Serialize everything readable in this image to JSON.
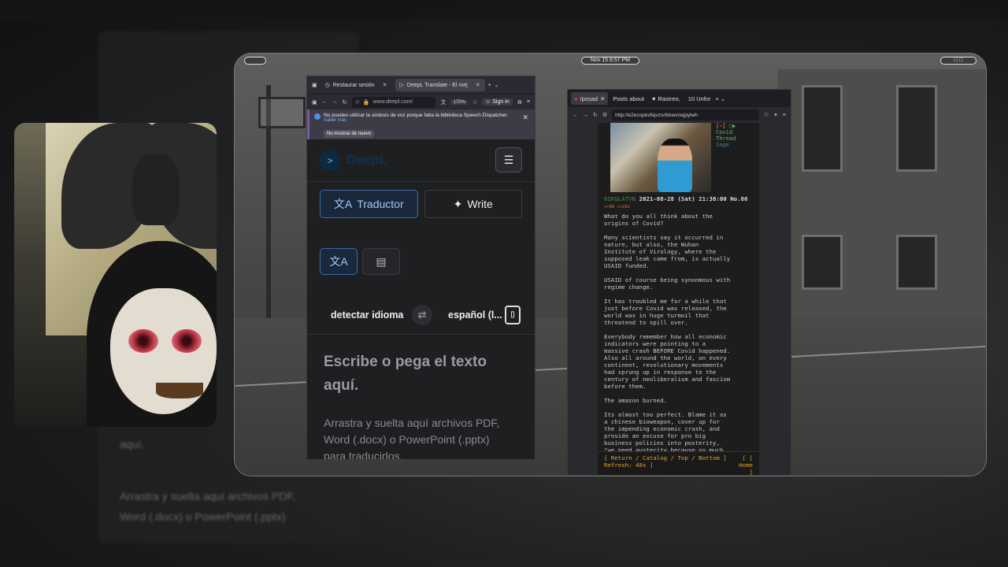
{
  "topbar": {
    "clock": "Nov 15   8:57 PM"
  },
  "deepl_window": {
    "tabs": [
      {
        "label": "Restaurar sesión"
      },
      {
        "label": "DeepL Translate - El mej"
      }
    ],
    "url": "www.deepl.com/",
    "zoom": "170%",
    "signin": "Sign in",
    "notice": {
      "text": "No puedes utilizar la síntesis de voz porque falta la biblioteca Speech Dispatcher.",
      "link": "Saber más",
      "button": "No mostrar de nuevo"
    },
    "brand": "DeepL",
    "modes": {
      "translator": "Traductor",
      "write": "Write"
    },
    "lang_source": "detectar idioma",
    "lang_target": "español (l...",
    "source_placeholder": "Escribe o pega el texto aquí.",
    "source_hint": "Arrastra y suelta aquí archivos PDF, Word (.docx) o PowerPoint (.pptx) para traducirlos."
  },
  "tor_window": {
    "tabs": [
      {
        "label": "/posad"
      },
      {
        "label": "Posts about"
      },
      {
        "label": "Rastreo,"
      },
      {
        "label": "10 Unfor"
      }
    ],
    "url": "http://e2ecopkv6qvzsrbikwxnejpylwh",
    "side": {
      "collapse": "[−]",
      "title1": "Covid",
      "title2": "Thread",
      "sage": "Sage"
    },
    "post": {
      "name": "6IKGLATVN",
      "date": "2021-08-28 (Sat) 21:38:00",
      "number": "No.86",
      "refs": ">>88 >>262",
      "body": "What do you all think about the\norigins of Covid?\n\nMany scientists say it occurred in\nnature, but also, the Wuhan\nInstitute of Virology, where the\nsupposed leak came from, is actually\nUSAID funded.\n\nUSAID of course being synonmous with\nregime change.\n\nIt has troubled me for a while that\njust before Covid was released, the\nworld was in huge turmoil that\nthreatend to spill over.\n\nEverybody remember how all economic\nindicators were pointing to a\nmassive crash BEFORE Covid happened.\nAlso all around the world, on every\ncontinent, revolutionary movements\nhad sprung up in response to the\ncentury of neoliberalism and fascism\nbefore them.\n\nThe amazon burned.\n\nIts almost too perfect. Blame it as\na chinese bioweapon, cover up for\nthe impending economic crash, and\nprovide an excuse for pro big\nbusiness policies into posterity,\n\"we need austerity because so much"
    },
    "footer": {
      "nav": "[ Return / Catalog / Top / Bottom ]",
      "refresh": "Refresh: 48s ]",
      "home_open": "[ [",
      "home": "Home",
      "home_close": "]"
    }
  },
  "background_text": {
    "line1": "Arrastra y suelta aquí archivos PDF,",
    "line2": "Word (.docx) o PowerPoint (.pptx)",
    "line3": "aquí."
  }
}
